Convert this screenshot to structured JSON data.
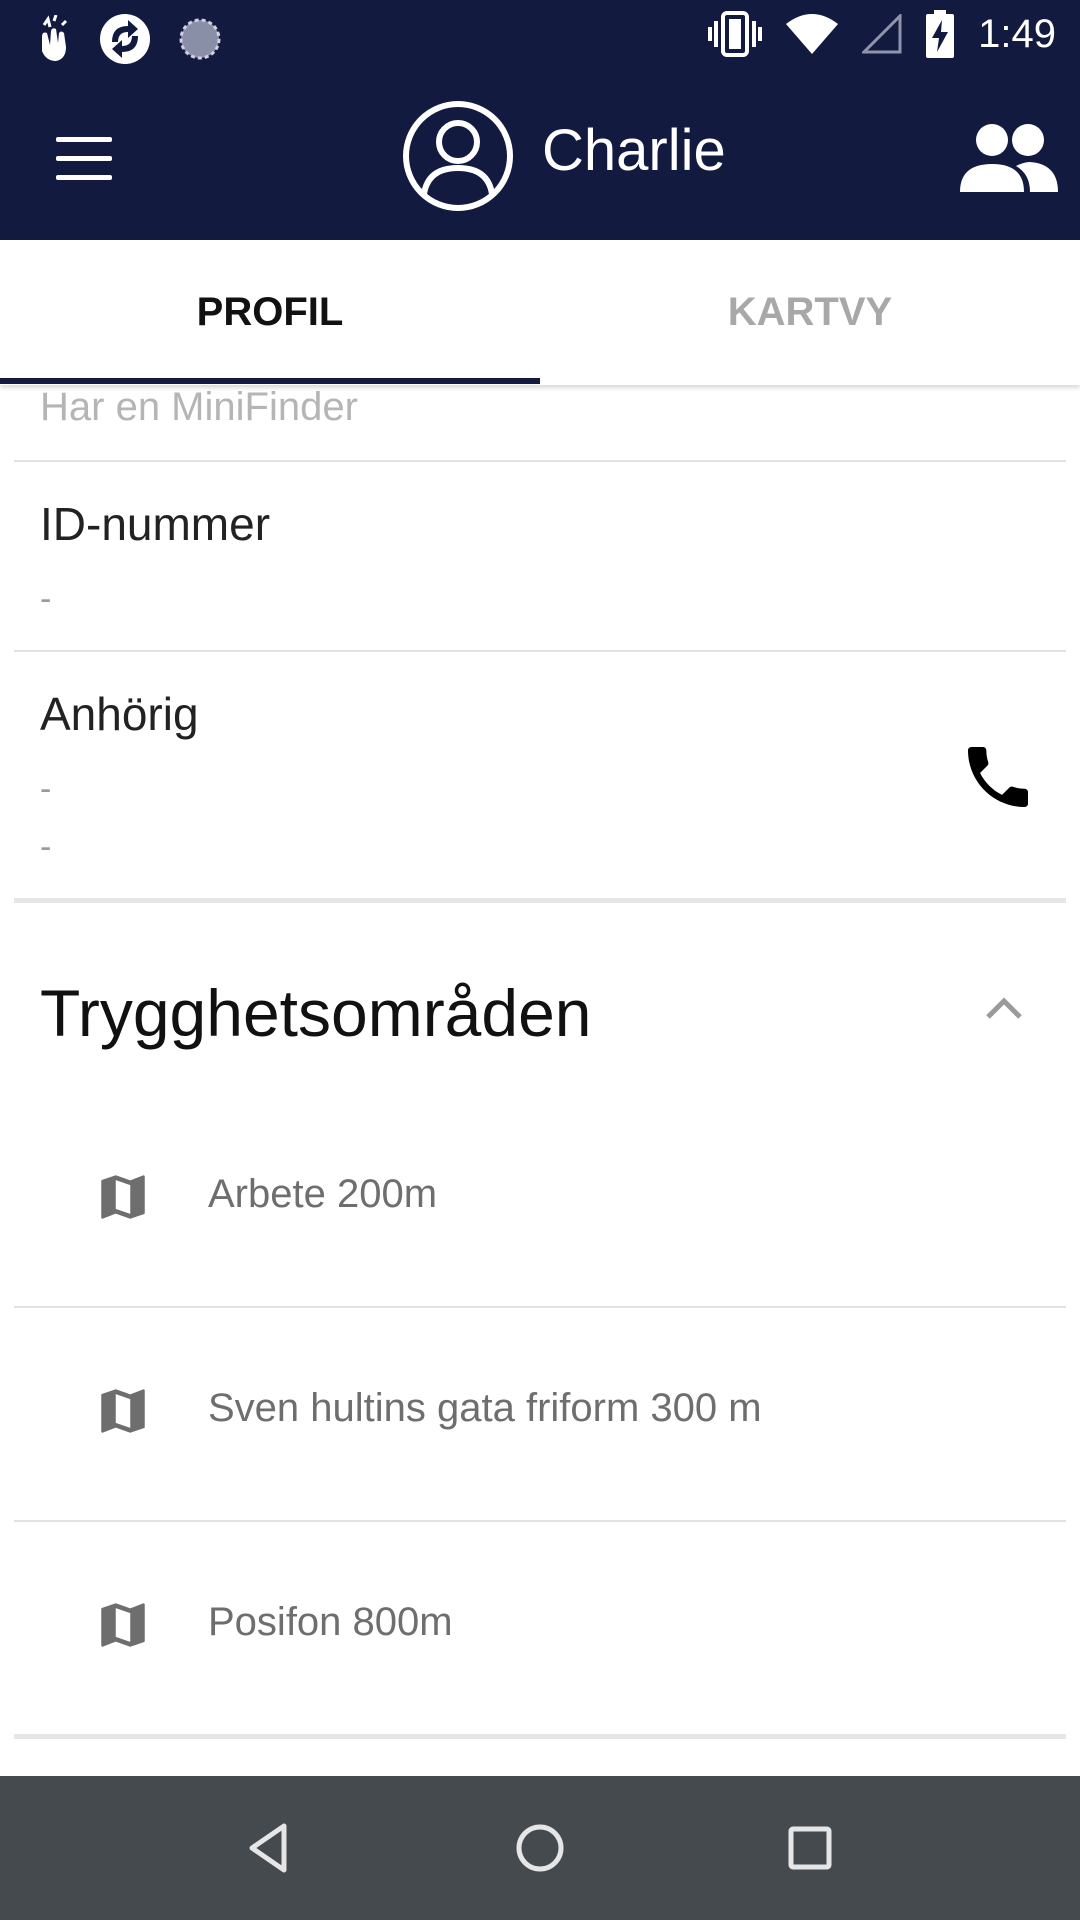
{
  "status_bar": {
    "time": "1:49",
    "left_icons": [
      "hand-notification-icon",
      "sync-notification-icon",
      "loading-notification-icon"
    ],
    "right_icons": [
      "vibrate-icon",
      "wifi-icon",
      "cell-signal-icon",
      "battery-charging-icon"
    ]
  },
  "toolbar": {
    "title": "Charlie",
    "menu_icon": "hamburger-menu-icon",
    "avatar_icon": "user-avatar-icon",
    "group_icon": "group-icon"
  },
  "tabs": [
    {
      "label": "PROFIL",
      "active": true
    },
    {
      "label": "KARTVY",
      "active": false
    }
  ],
  "profile": {
    "partial_text": "Har en MiniFinder",
    "id_field": {
      "label": "ID-nummer",
      "value": "-"
    },
    "relative_field": {
      "label": "Anhörig",
      "values": [
        "-",
        "-"
      ]
    }
  },
  "safety_areas": {
    "title": "Trygghetsområden",
    "items": [
      {
        "label": "Arbete 200m",
        "icon": "map-icon"
      },
      {
        "label": "Sven hultins gata friform 300 m",
        "icon": "map-icon"
      },
      {
        "label": "Posifon 800m",
        "icon": "map-icon"
      }
    ]
  },
  "colors": {
    "primary": "#131a40",
    "nav_bar": "#454a4f",
    "divider": "#e2e2e2",
    "inactive_tab": "#a8a8a8"
  }
}
